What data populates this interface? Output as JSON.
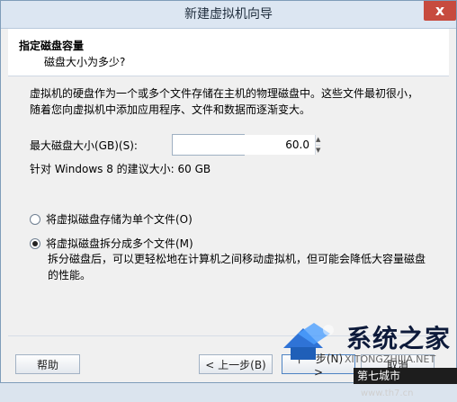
{
  "window": {
    "title": "新建虚拟机向导",
    "close_glyph": "x"
  },
  "header": {
    "title": "指定磁盘容量",
    "subtitle": "磁盘大小为多少?"
  },
  "content": {
    "description": "虚拟机的硬盘作为一个或多个文件存储在主机的物理磁盘中。这些文件最初很小，随着您向虚拟机中添加应用程序、文件和数据而逐渐变大。",
    "max_size_label": "最大磁盘大小(GB)(S):",
    "max_size_value": "60.0",
    "spinner_up": "▲",
    "spinner_down": "▼",
    "recommend_text": "针对 Windows 8 的建议大小: 60 GB",
    "option_single": "将虚拟磁盘存储为单个文件(O)",
    "option_split": "将虚拟磁盘拆分成多个文件(M)",
    "split_desc": "拆分磁盘后，可以更轻松地在计算机之间移动虚拟机，但可能会降低大容量磁盘的性能。"
  },
  "footer": {
    "help": "帮助",
    "back": "< 上一步(B)",
    "next": "下一步(N) >",
    "cancel": "取消"
  },
  "watermark": {
    "title": "系统之家",
    "url": "XITONGZHIJIA.NET",
    "bottom_text": "第七城市",
    "bottom_url": "www.th7.cn"
  },
  "colors": {
    "accent": "#4d83c3",
    "close": "#c74b3e"
  }
}
